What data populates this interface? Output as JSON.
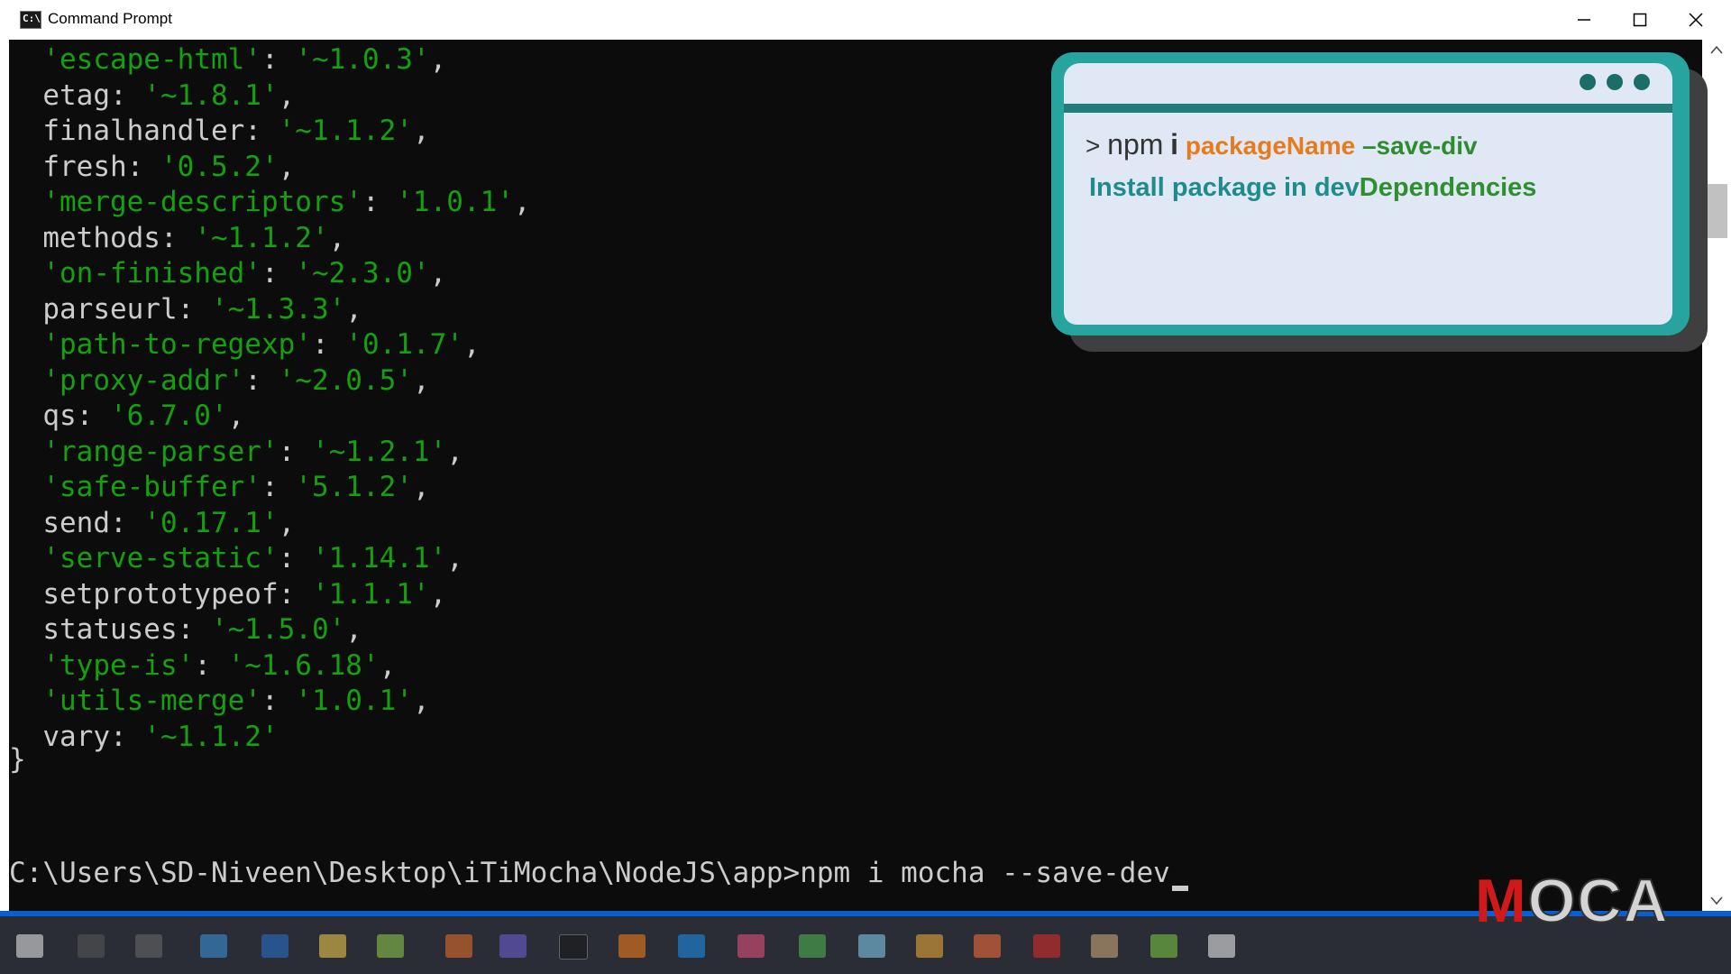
{
  "window": {
    "title": "Command Prompt"
  },
  "terminal": {
    "lines": [
      {
        "key": "'escape-html'",
        "value": "'~1.0.3'",
        "suffix": ","
      },
      {
        "key": "etag",
        "value": "'~1.8.1'",
        "suffix": ","
      },
      {
        "key": "finalhandler",
        "value": "'~1.1.2'",
        "suffix": ","
      },
      {
        "key": "fresh",
        "value": "'0.5.2'",
        "suffix": ","
      },
      {
        "key": "'merge-descriptors'",
        "value": "'1.0.1'",
        "suffix": ","
      },
      {
        "key": "methods",
        "value": "'~1.1.2'",
        "suffix": ","
      },
      {
        "key": "'on-finished'",
        "value": "'~2.3.0'",
        "suffix": ","
      },
      {
        "key": "parseurl",
        "value": "'~1.3.3'",
        "suffix": ","
      },
      {
        "key": "'path-to-regexp'",
        "value": "'0.1.7'",
        "suffix": ","
      },
      {
        "key": "'proxy-addr'",
        "value": "'~2.0.5'",
        "suffix": ","
      },
      {
        "key": "qs",
        "value": "'6.7.0'",
        "suffix": ","
      },
      {
        "key": "'range-parser'",
        "value": "'~1.2.1'",
        "suffix": ","
      },
      {
        "key": "'safe-buffer'",
        "value": "'5.1.2'",
        "suffix": ","
      },
      {
        "key": "send",
        "value": "'0.17.1'",
        "suffix": ","
      },
      {
        "key": "'serve-static'",
        "value": "'1.14.1'",
        "suffix": ","
      },
      {
        "key": "setprototypeof",
        "value": "'1.1.1'",
        "suffix": ","
      },
      {
        "key": "statuses",
        "value": "'~1.5.0'",
        "suffix": ","
      },
      {
        "key": "'type-is'",
        "value": "'~1.6.18'",
        "suffix": ","
      },
      {
        "key": "'utils-merge'",
        "value": "'1.0.1'",
        "suffix": ","
      },
      {
        "key": "vary",
        "value": "'~1.1.2'",
        "suffix": ""
      }
    ],
    "closing_brace": "}",
    "prompt_path": "C:\\Users\\SD-Niveen\\Desktop\\iTiMocha\\NodeJS\\app>",
    "prompt_command": "npm i mocha --save-dev"
  },
  "overlay": {
    "chevron": ">",
    "npm": "npm",
    "i": "i",
    "package": "packageName",
    "flag": "–save-div",
    "desc_part1": "Install package in dev",
    "desc_part2": "Dependencies"
  },
  "logo": {
    "m": "M",
    "rest": "OCA"
  },
  "colors": {
    "string_green": "#13a10e",
    "terminal_bg": "#0c0c0c",
    "overlay_teal": "#27a3a0",
    "overlay_orange": "#e87a1a"
  }
}
